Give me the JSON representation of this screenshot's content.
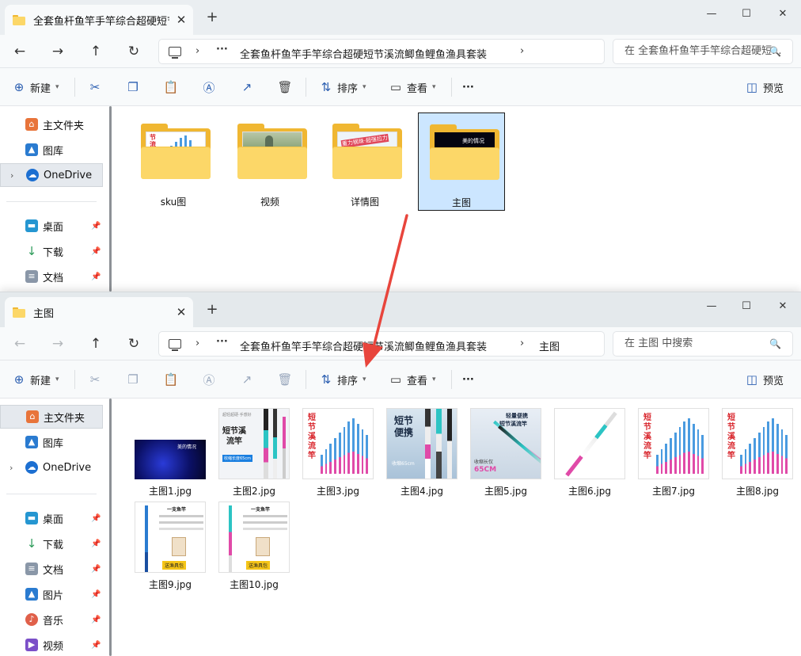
{
  "window1": {
    "tab_title": "全套鱼杆鱼竿手竿综合超硬短节",
    "address": [
      "全套鱼杆鱼竿手竿综合超硬短节溪流鲫鱼鲤鱼渔具套装"
    ],
    "search_placeholder": "在 全套鱼杆鱼竿手竿综合超硬短...",
    "folders": [
      {
        "name": "sku图"
      },
      {
        "name": "视频"
      },
      {
        "name": "详情图"
      },
      {
        "name": "主图",
        "selected": true
      }
    ],
    "sidebar": [
      {
        "label": "主文件夹",
        "icon": "home-icon"
      },
      {
        "label": "图库",
        "icon": "gallery-icon"
      },
      {
        "label": "OneDrive",
        "icon": "cloud-icon",
        "selected": true
      },
      {
        "label": "桌面",
        "icon": "desktop-icon",
        "pinned": true
      },
      {
        "label": "下载",
        "icon": "download-icon",
        "pinned": true
      },
      {
        "label": "文档",
        "icon": "document-icon",
        "pinned": true
      }
    ]
  },
  "window2": {
    "tab_title": "主图",
    "address": [
      "全套鱼杆鱼竿手竿综合超硬短节溪流鲫鱼鲤鱼渔具套装",
      "主图"
    ],
    "search_placeholder": "在 主图 中搜索",
    "files": [
      {
        "name": "主图1.jpg"
      },
      {
        "name": "主图2.jpg"
      },
      {
        "name": "主图3.jpg"
      },
      {
        "name": "主图4.jpg"
      },
      {
        "name": "主图5.jpg"
      },
      {
        "name": "主图6.jpg"
      },
      {
        "name": "主图7.jpg"
      },
      {
        "name": "主图8.jpg"
      },
      {
        "name": "主图9.jpg"
      },
      {
        "name": "主图10.jpg"
      }
    ],
    "sidebar": [
      {
        "label": "主文件夹",
        "icon": "home-icon",
        "selected": true
      },
      {
        "label": "图库",
        "icon": "gallery-icon"
      },
      {
        "label": "OneDrive",
        "icon": "cloud-icon"
      },
      {
        "label": "桌面",
        "icon": "desktop-icon",
        "pinned": true
      },
      {
        "label": "下载",
        "icon": "download-icon",
        "pinned": true
      },
      {
        "label": "文档",
        "icon": "document-icon",
        "pinned": true
      },
      {
        "label": "图片",
        "icon": "pictures-icon",
        "pinned": true
      },
      {
        "label": "音乐",
        "icon": "music-icon",
        "pinned": true
      },
      {
        "label": "视频",
        "icon": "video-icon",
        "pinned": true
      }
    ]
  },
  "toolbar": {
    "new_label": "新建",
    "sort_label": "排序",
    "view_label": "查看",
    "more_label": "···",
    "preview_label": "预览"
  },
  "thumb_text": {
    "sku_folder": "节流竿",
    "detail_folder": "重力钢珠·超强拉力",
    "main_dark": "美的情况",
    "t2_title": "短节溪流竿",
    "t2_tag": "超轻超硬·手感好",
    "t2_sub": "收缩长度65cm",
    "t3_red": "短节溪流竿",
    "t4_title": "短节便携",
    "t4_sub": "收缩65cm",
    "t5_title1": "轻量便携",
    "t5_title2": "短节溪流竿",
    "t5_sub1": "收缩长仅",
    "t5_sub2": "65CM",
    "t9_title": "一支鱼竿",
    "t9_badge": "送渔具包",
    "t10_badge": "送渔具包"
  },
  "colors": {
    "folder": "#f0b732",
    "folder_front": "#fcd768",
    "selection": "#cce6ff",
    "accent": "#2a5db0",
    "arrow": "#e8453c"
  }
}
